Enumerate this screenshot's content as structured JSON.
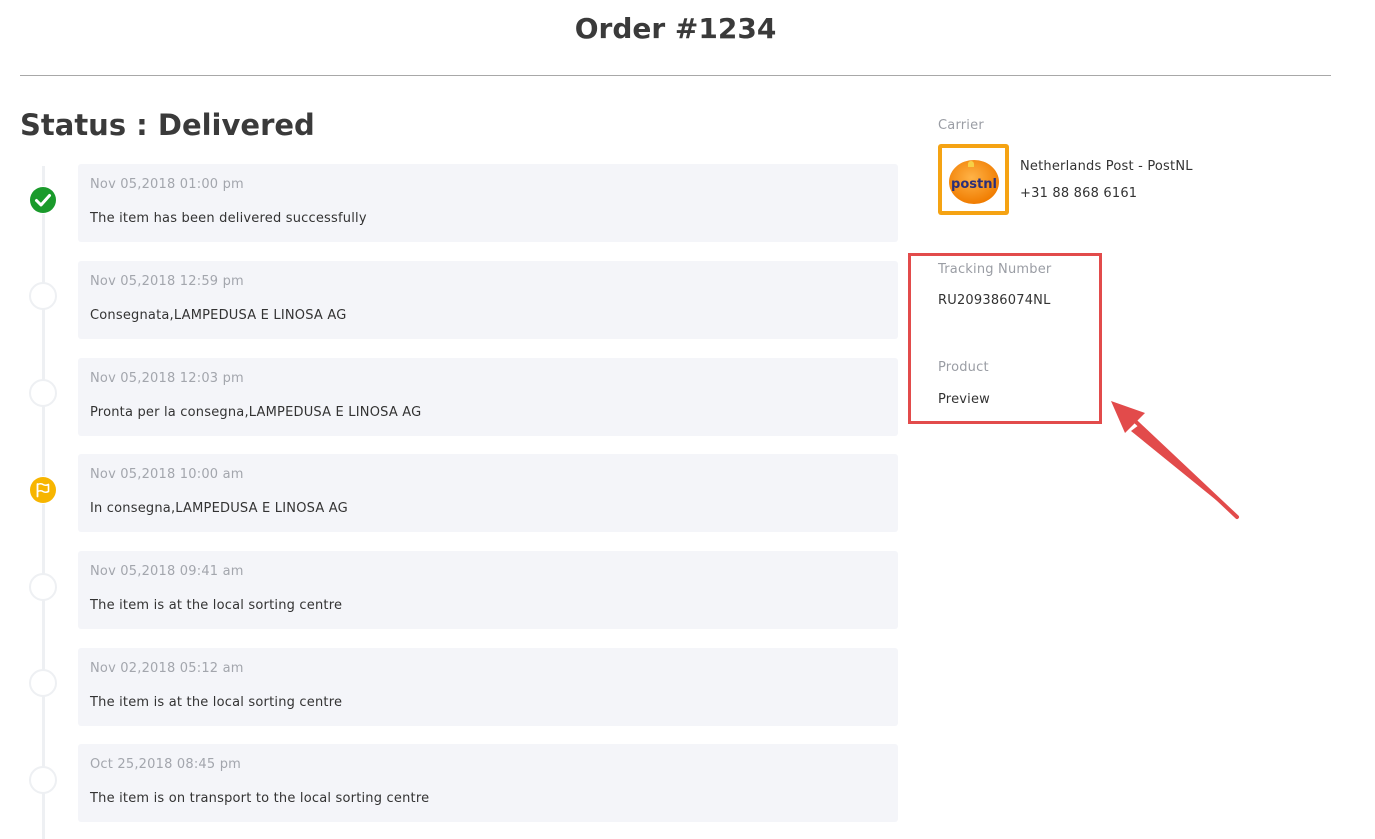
{
  "order": {
    "title": "Order #1234",
    "status": "Status : Delivered"
  },
  "events": [
    {
      "time": "Nov 05,2018 01:00 pm",
      "description": "The item has been delivered successfully",
      "marker": "check-icon"
    },
    {
      "time": "Nov 05,2018 12:59 pm",
      "description": "Consegnata,LAMPEDUSA E LINOSA AG",
      "marker": "empty"
    },
    {
      "time": "Nov 05,2018 12:03 pm",
      "description": "Pronta per la consegna,LAMPEDUSA E LINOSA AG",
      "marker": "empty"
    },
    {
      "time": "Nov 05,2018 10:00 am",
      "description": "In consegna,LAMPEDUSA E LINOSA AG",
      "marker": "flag-icon"
    },
    {
      "time": "Nov 05,2018 09:41 am",
      "description": "The item is at the local sorting centre",
      "marker": "empty"
    },
    {
      "time": "Nov 02,2018 05:12 am",
      "description": "The item is at the local sorting centre",
      "marker": "empty"
    },
    {
      "time": "Oct 25,2018 08:45 pm",
      "description": "The item is on transport to the local sorting centre",
      "marker": "empty"
    }
  ],
  "carrier": {
    "label": "Carrier",
    "name": "Netherlands Post - PostNL",
    "phone": "+31 88 868 6161",
    "logo_text": "postnl",
    "logo_color": "#f5a313"
  },
  "tracking": {
    "label": "Tracking Number",
    "value": "RU209386074NL"
  },
  "product": {
    "label": "Product",
    "value": "Preview"
  },
  "colors": {
    "delivered": "#1a9a2b",
    "in_transit": "#f7b500",
    "highlight": "#e24b4b"
  }
}
